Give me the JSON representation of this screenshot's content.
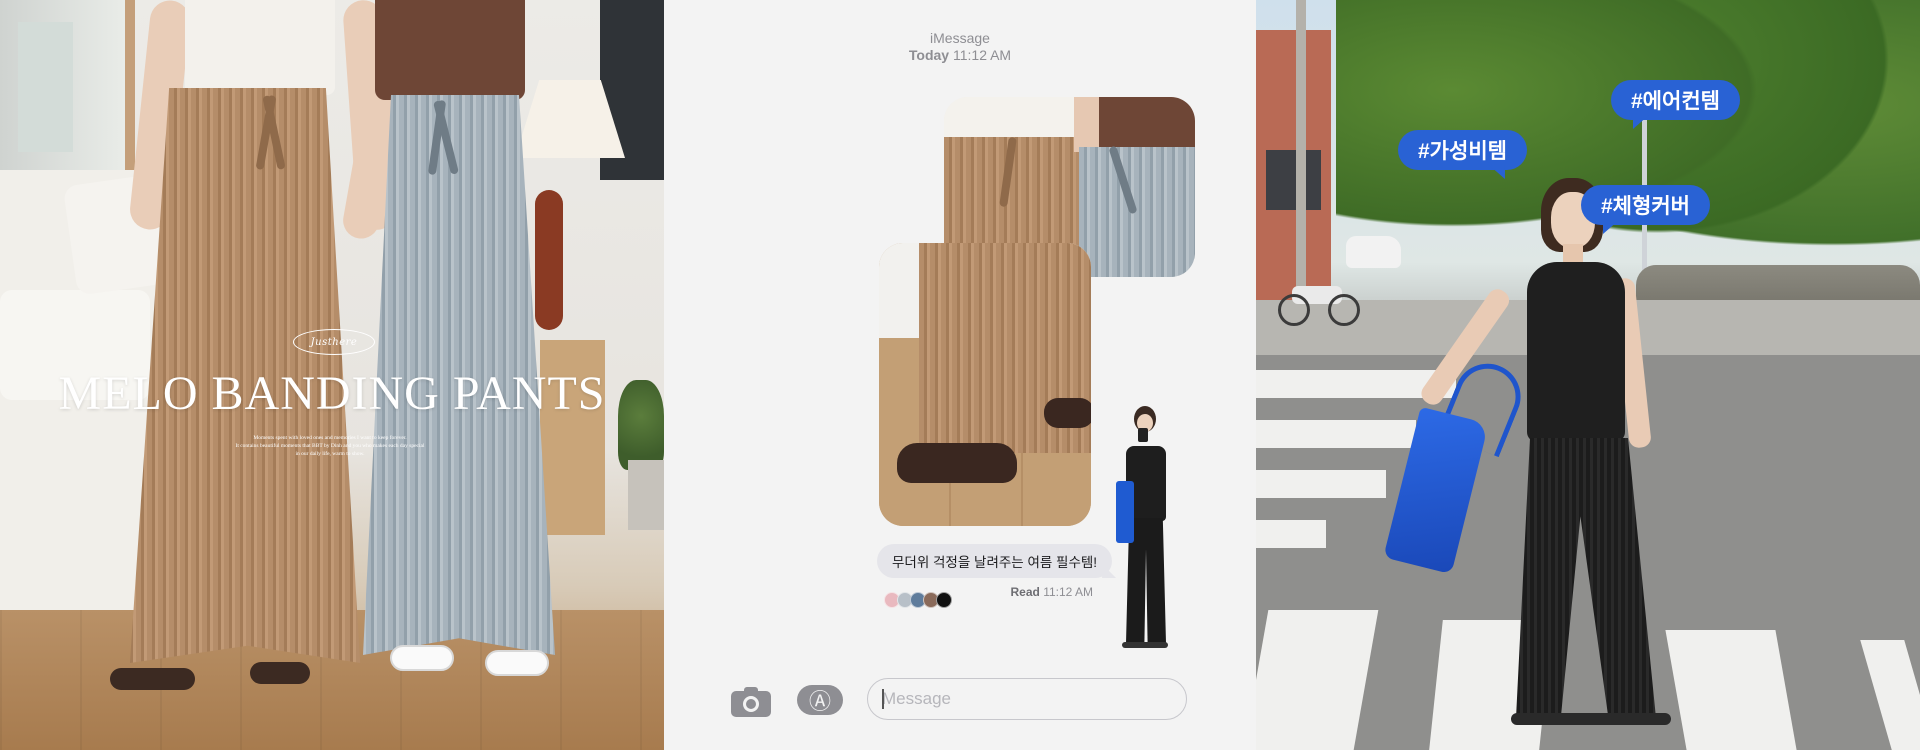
{
  "left_panel": {
    "logo_text": "Justhere",
    "title": "MELO BANDING PANTS",
    "subtitle_lines": [
      "Moments spent with loved ones and memories I want to keep forever.",
      "It contains beautiful moments that BBT by Dinh and you who makes each day special",
      "in our daily life, warm to show."
    ]
  },
  "middle_panel": {
    "header": {
      "service": "iMessage",
      "day": "Today",
      "time": "11:12 AM"
    },
    "message_text": "무더위 걱정을 날려주는 여름 필수템!",
    "read_receipt": {
      "label": "Read",
      "time": "11:12 AM"
    },
    "color_swatches": [
      "#e9b9bf",
      "#b8c0c8",
      "#5f7c9c",
      "#8a6a5a",
      "#111111"
    ],
    "input": {
      "placeholder": "Message",
      "value": ""
    },
    "icons": {
      "camera": "camera-icon",
      "app_store": "app-store-icon"
    }
  },
  "right_panel": {
    "hashtags": [
      "#가성비템",
      "#에어컨템",
      "#체형커버"
    ],
    "accent_color": "#2962d4"
  }
}
